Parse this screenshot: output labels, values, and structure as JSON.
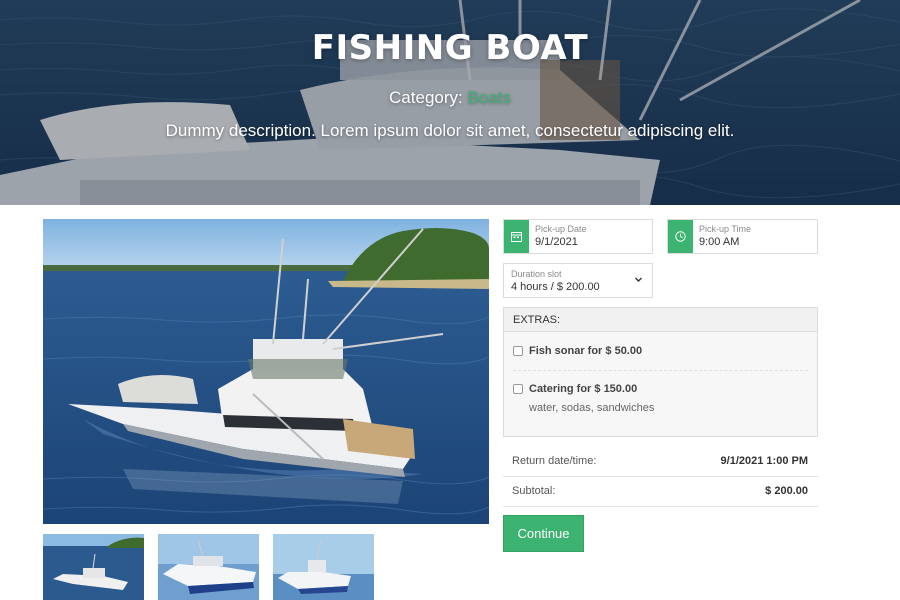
{
  "hero": {
    "title": "FISHING BOAT",
    "category_prefix": "Category:",
    "category_link": "Boats",
    "description": "Dummy description. Lorem ipsum dolor sit amet, consectetur adipiscing elit."
  },
  "booking": {
    "pickup_date": {
      "label": "Pick-up Date",
      "value": "9/1/2021",
      "icon": "calendar-icon"
    },
    "pickup_time": {
      "label": "Pick-up Time",
      "value": "9:00 AM",
      "icon": "clock-icon"
    },
    "duration": {
      "label": "Duration slot",
      "value": "4 hours / $ 200.00"
    }
  },
  "extras": {
    "header": "EXTRAS:",
    "items": [
      {
        "label": "Fish sonar for $ 50.00",
        "sub": ""
      },
      {
        "label": "Catering for $ 150.00",
        "sub": "water, sodas, sandwiches"
      }
    ]
  },
  "summary": {
    "return_label": "Return date/time:",
    "return_value": "9/1/2021 1:00 PM",
    "subtotal_label": "Subtotal:",
    "subtotal_value": "$ 200.00"
  },
  "actions": {
    "continue_label": "Continue"
  },
  "colors": {
    "accent": "#3cb371",
    "border": "#dcdcdc",
    "panel_bg": "#f7f7f7"
  }
}
